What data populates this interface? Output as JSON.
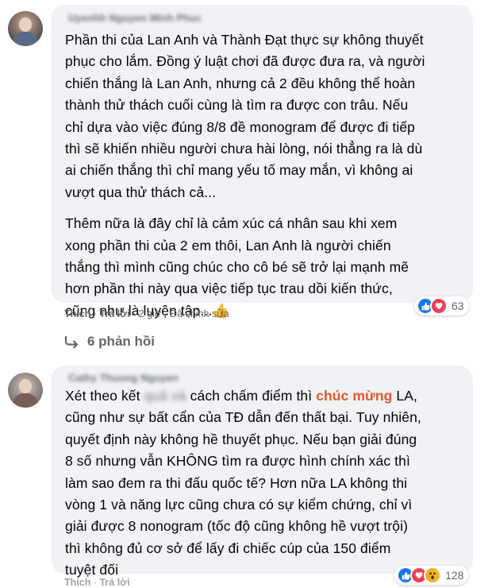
{
  "comments": [
    {
      "author": "Uyenhh Nguyen Minh Phuc",
      "paragraphs": [
        "Phần thi của Lan Anh và Thành Đạt thực sự không thuyết\nphục cho lắm. Đồng ý luật chơi đã được đưa ra, và người\nchiến thắng là Lan Anh, nhưng cả 2 đều không thể hoàn\nthành thử thách cuối cùng là tìm ra được con trâu. Nếu\nchỉ dựa vào việc đúng 8/8 đề monogram để được đi tiếp\nthì sẽ khiến nhiều người chưa hài lòng, nói thẳng ra là dù\nai chiến thắng thì chỉ mang yếu tố may mắn, vì không ai\nvượt qua thử thách cả...",
        "Thêm nữa là đây chỉ là cảm xúc cá nhân sau khi xem\nxong phần thi của 2 em thôi, Lan Anh là người chiến\nthắng thì mình cũng chúc cho cô bé sẽ trở lại mạnh mẽ\nhơn phần thi này qua việc tiếp tục trau dồi kiến thức,\ncũng như là luyện tập..."
      ],
      "emoji": "👍",
      "like_label": "Thích",
      "reply_label": "Trả lời",
      "time": "2 giờ",
      "edited": "Đã chỉnh sửa",
      "reaction_count": "63",
      "reactions": [
        "like-icon",
        "love-icon"
      ],
      "replies_label": "6 phản hồi"
    },
    {
      "author": "Cathy Thuong Nguyen",
      "text_before_blur": "Xét theo kết ",
      "text_blur": "quả và",
      "text_mid": " cách chấm điểm thì ",
      "highlight": "chúc mừng",
      "text_after": " LA,\ncũng như sự bất cẩn của TĐ dẫn đến thất bại. Tuy nhiên,\nquyết định này không hề thuyết phục. Nếu bạn giải đúng\n8 số nhưng vẫn KHÔNG tìm ra được hình chính xác thì\nlàm sao đem ra thi đấu quốc tế? Hơn nữa LA không thi\nvòng 1 và năng lực cũng chưa có sự kiểm chứng, chỉ vì\ngiải được 8 nonogram (tốc độ cũng không hề vượt trội)\nthì không đủ cơ sở để lấy đi chiếc cúp của 150 điểm\ntuyệt đối",
      "highlight_color": "#e4572e",
      "like_label": "Thích",
      "reply_label": "Trả lời",
      "reaction_count": "128",
      "reactions": [
        "like-icon",
        "love-icon",
        "wow-icon"
      ]
    }
  ],
  "colors": {
    "bubble": "#f0f2f5",
    "secondary_text": "#65676b",
    "like_blue": "#1877f2",
    "love_red": "#f33e58",
    "wow_yellow": "#f7b125"
  }
}
